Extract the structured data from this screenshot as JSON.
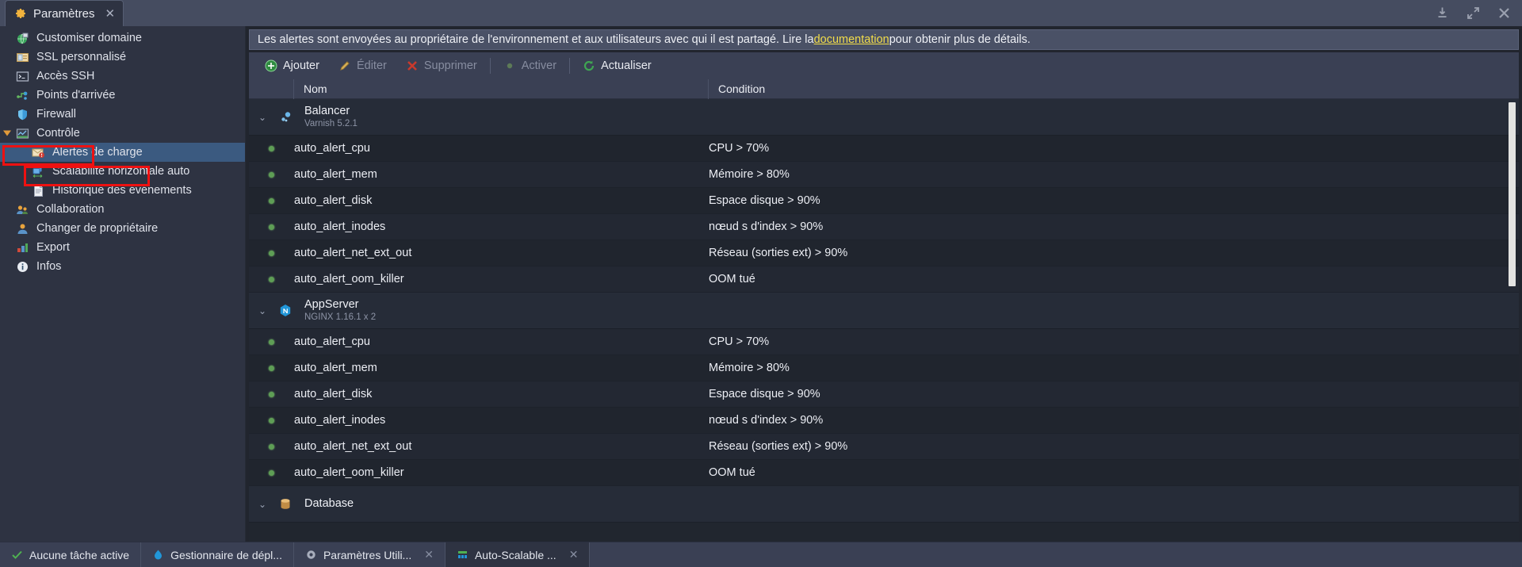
{
  "window": {
    "tab_title": "Paramètres",
    "tab_close_glyph": "✕",
    "controls": [
      {
        "name": "download-icon"
      },
      {
        "name": "maximize-icon"
      },
      {
        "name": "close-icon"
      }
    ]
  },
  "sidebar": {
    "items": [
      {
        "label": "Customiser domaine",
        "icon": "globe-icon",
        "level": 0,
        "selected": false,
        "caret": ""
      },
      {
        "label": "SSL personnalisé",
        "icon": "certificate-icon",
        "level": 0,
        "selected": false,
        "caret": ""
      },
      {
        "label": "Accès SSH",
        "icon": "terminal-icon",
        "level": 0,
        "selected": false,
        "caret": ""
      },
      {
        "label": "Points d'arrivée",
        "icon": "endpoints-icon",
        "level": 0,
        "selected": false,
        "caret": ""
      },
      {
        "label": "Firewall",
        "icon": "shield-icon",
        "level": 0,
        "selected": false,
        "caret": ""
      },
      {
        "label": "Contrôle",
        "icon": "monitoring-icon",
        "level": 0,
        "selected": false,
        "caret": "down"
      },
      {
        "label": "Alertes de charge",
        "icon": "mail-alert-icon",
        "level": 1,
        "selected": true,
        "caret": ""
      },
      {
        "label": "Scalabilité horizontale auto",
        "icon": "autoscaling-icon",
        "level": 1,
        "selected": false,
        "caret": ""
      },
      {
        "label": "Historique des événements",
        "icon": "document-icon",
        "level": 1,
        "selected": false,
        "caret": ""
      },
      {
        "label": "Collaboration",
        "icon": "users-icon",
        "level": 0,
        "selected": false,
        "caret": ""
      },
      {
        "label": "Changer de propriétaire",
        "icon": "user-icon",
        "level": 0,
        "selected": false,
        "caret": ""
      },
      {
        "label": "Export",
        "icon": "export-icon",
        "level": 0,
        "selected": false,
        "caret": ""
      },
      {
        "label": "Infos",
        "icon": "info-icon",
        "level": 0,
        "selected": false,
        "caret": ""
      }
    ]
  },
  "infobar": {
    "text_before": "Les alertes sont envoyées au propriétaire de l'environnement et aux utilisateurs avec qui il est partagé. Lire la ",
    "link": "documentation",
    "text_after": " pour obtenir plus de détails."
  },
  "toolbar": {
    "buttons": [
      {
        "label": "Ajouter",
        "icon": "add-icon",
        "disabled": false
      },
      {
        "label": "Éditer",
        "icon": "edit-icon",
        "disabled": true
      },
      {
        "label": "Supprimer",
        "icon": "delete-icon",
        "disabled": true
      },
      {
        "label": "Activer",
        "icon": "enable-icon",
        "disabled": true
      },
      {
        "label": "Actualiser",
        "icon": "refresh-icon",
        "disabled": false
      }
    ]
  },
  "table": {
    "columns": [
      "",
      "Nom",
      "Condition"
    ],
    "groups": [
      {
        "name": "Balancer",
        "version": "Varnish 5.2.1",
        "icon": "balancer-icon",
        "expanded": true,
        "rows": [
          {
            "name": "auto_alert_cpu",
            "condition": "CPU > 70%",
            "status": "enabled"
          },
          {
            "name": "auto_alert_mem",
            "condition": "Mémoire > 80%",
            "status": "enabled"
          },
          {
            "name": "auto_alert_disk",
            "condition": "Espace disque > 90%",
            "status": "enabled"
          },
          {
            "name": "auto_alert_inodes",
            "condition": "nœud s d'index > 90%",
            "status": "enabled"
          },
          {
            "name": "auto_alert_net_ext_out",
            "condition": "Réseau (sorties ext) > 90%",
            "status": "enabled"
          },
          {
            "name": "auto_alert_oom_killer",
            "condition": "OOM tué",
            "status": "enabled"
          }
        ]
      },
      {
        "name": "AppServer",
        "version": "NGINX 1.16.1 x 2",
        "icon": "nginx-icon",
        "expanded": true,
        "rows": [
          {
            "name": "auto_alert_cpu",
            "condition": "CPU > 70%",
            "status": "enabled"
          },
          {
            "name": "auto_alert_mem",
            "condition": "Mémoire > 80%",
            "status": "enabled"
          },
          {
            "name": "auto_alert_disk",
            "condition": "Espace disque > 90%",
            "status": "enabled"
          },
          {
            "name": "auto_alert_inodes",
            "condition": "nœud s d'index > 90%",
            "status": "enabled"
          },
          {
            "name": "auto_alert_net_ext_out",
            "condition": "Réseau (sorties ext) > 90%",
            "status": "enabled"
          },
          {
            "name": "auto_alert_oom_killer",
            "condition": "OOM tué",
            "status": "enabled"
          }
        ]
      },
      {
        "name": "Database",
        "version": "",
        "icon": "database-icon",
        "expanded": true,
        "rows": []
      }
    ]
  },
  "taskbar": {
    "items": [
      {
        "label": "Aucune tâche active",
        "icon": "check-icon",
        "closable": false,
        "active": false
      },
      {
        "label": "Gestionnaire de dépl...",
        "icon": "deploy-icon",
        "closable": false,
        "active": false
      },
      {
        "label": "Paramètres Utili...",
        "icon": "gear-icon",
        "closable": true,
        "active": false
      },
      {
        "label": "Auto-Scalable ...",
        "icon": "grid-icon",
        "closable": true,
        "active": true
      }
    ],
    "close_glyph": "✕"
  },
  "colors": {
    "accent_selected": "#3b5a80",
    "highlight_box": "#ee1111",
    "link": "#f2dd4a",
    "status_dot": "#5e9e55"
  }
}
